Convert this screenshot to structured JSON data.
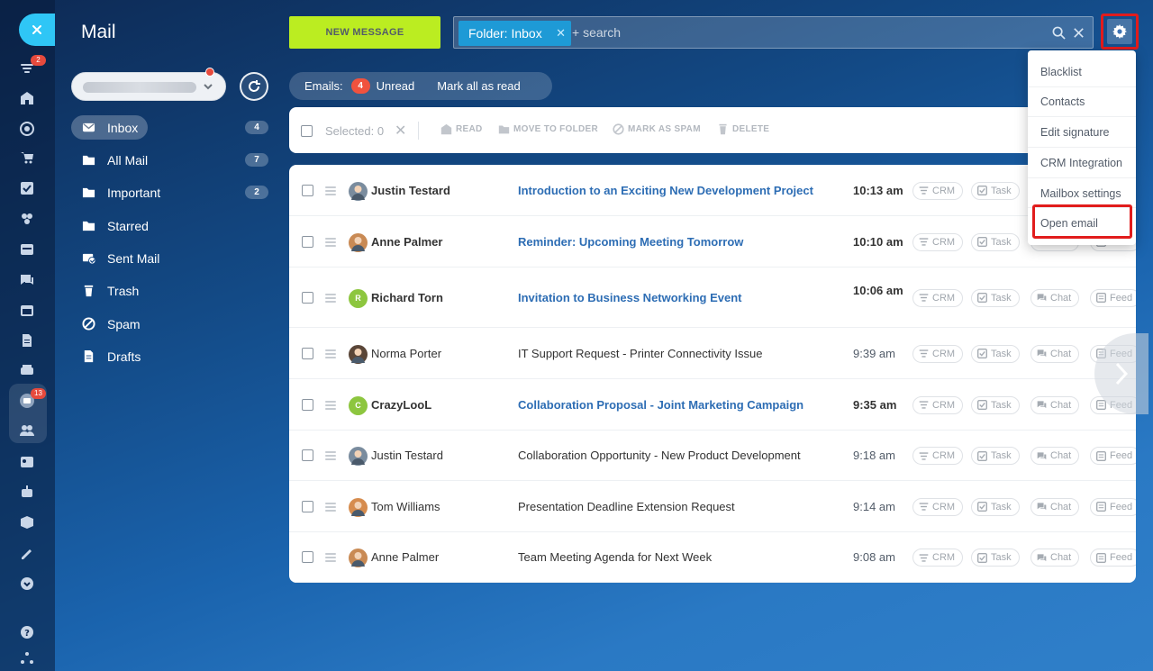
{
  "app_title": "Mail",
  "rail": {
    "badges": {
      "feed": "2",
      "mail": "13"
    }
  },
  "folders": [
    {
      "label": "Inbox",
      "count": "4",
      "icon": "inbox-icon"
    },
    {
      "label": "All Mail",
      "count": "7",
      "icon": "folder-icon"
    },
    {
      "label": "Important",
      "count": "2",
      "icon": "folder-icon"
    },
    {
      "label": "Starred",
      "count": "",
      "icon": "folder-icon"
    },
    {
      "label": "Sent Mail",
      "count": "",
      "icon": "sent-icon"
    },
    {
      "label": "Trash",
      "count": "",
      "icon": "trash-icon"
    },
    {
      "label": "Spam",
      "count": "",
      "icon": "spam-icon"
    },
    {
      "label": "Drafts",
      "count": "",
      "icon": "drafts-icon"
    }
  ],
  "toolbar": {
    "new_message": "NEW MESSAGE",
    "folder_chip": "Folder: Inbox",
    "search_placeholder": "+ search"
  },
  "emails_bar": {
    "label": "Emails:",
    "unread_count": "4",
    "unread_label": "Unread",
    "mark_all": "Mark all as read"
  },
  "bulk": {
    "selected": "Selected: 0",
    "read": "READ",
    "move": "MOVE TO FOLDER",
    "spam": "MARK AS SPAM",
    "delete": "DELETE"
  },
  "tags": {
    "crm": "CRM",
    "task": "Task",
    "chat": "Chat",
    "feed": "Feed"
  },
  "emails": [
    {
      "from": "Justin Testard",
      "subject": "Introduction to an Exciting New Development Project",
      "time": "10:13 am",
      "unread": true
    },
    {
      "from": "Anne Palmer",
      "subject": "Reminder: Upcoming Meeting Tomorrow",
      "time": "10:10 am",
      "unread": true
    },
    {
      "from": "Richard Torn",
      "subject": "Invitation to Business Networking Event",
      "time": "10:06 am",
      "unread": true,
      "initial": "R"
    },
    {
      "from": "Norma Porter",
      "subject": "IT Support Request - Printer Connectivity Issue",
      "time": "9:39 am",
      "unread": false
    },
    {
      "from": "CrazyLooL",
      "subject": "Collaboration Proposal - Joint Marketing Campaign",
      "time": "9:35 am",
      "unread": true,
      "initial": "C"
    },
    {
      "from": "Justin Testard",
      "subject": "Collaboration Opportunity - New Product Development",
      "time": "9:18 am",
      "unread": false
    },
    {
      "from": "Tom Williams",
      "subject": "Presentation Deadline Extension Request",
      "time": "9:14 am",
      "unread": false
    },
    {
      "from": "Anne Palmer",
      "subject": "Team Meeting Agenda for Next Week",
      "time": "9:08 am",
      "unread": false
    }
  ],
  "settings_menu": [
    "Blacklist",
    "Contacts",
    "Edit signature",
    "CRM Integration",
    "Mailbox settings",
    "Open email"
  ],
  "colors": {
    "accent_green": "#bbed21",
    "highlight_red": "#e11c1c",
    "badge_red": "#f0523e",
    "link_blue": "#2d6db4"
  }
}
